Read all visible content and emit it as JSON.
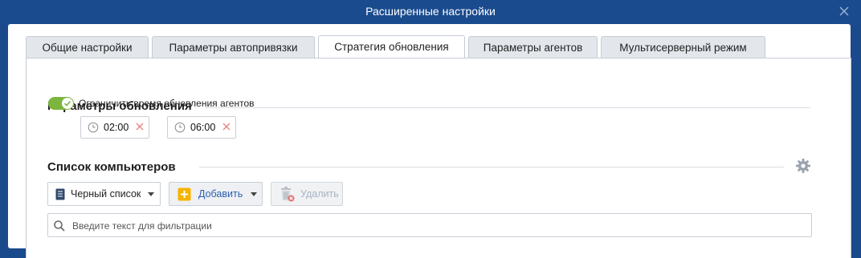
{
  "window": {
    "title": "Расширенные настройки"
  },
  "tabs": [
    {
      "label": "Общие настройки"
    },
    {
      "label": "Параметры автопривязки"
    },
    {
      "label": "Стратегия обновления"
    },
    {
      "label": "Параметры агентов"
    },
    {
      "label": "Мультисерверный режим"
    }
  ],
  "active_tab": "Стратегия обновления",
  "update_params": {
    "title": "Параметры обновления",
    "limit_toggle_label": "Ограничить время обновления агентов",
    "limit_toggle_on": true,
    "time_from": "02:00",
    "separator": "-",
    "time_to": "06:00"
  },
  "computers": {
    "title": "Список компьютеров",
    "list_type": "Черный список",
    "add_label": "Добавить",
    "delete_label": "Удалить",
    "filter_placeholder": "Введите текст для фильтрации"
  },
  "colors": {
    "titlebar": "#1a4b8e",
    "toggle_on": "#7cb53e",
    "add_icon": "#f5b400",
    "add_text": "#2a5fb0",
    "clear_x": "#e88080"
  }
}
